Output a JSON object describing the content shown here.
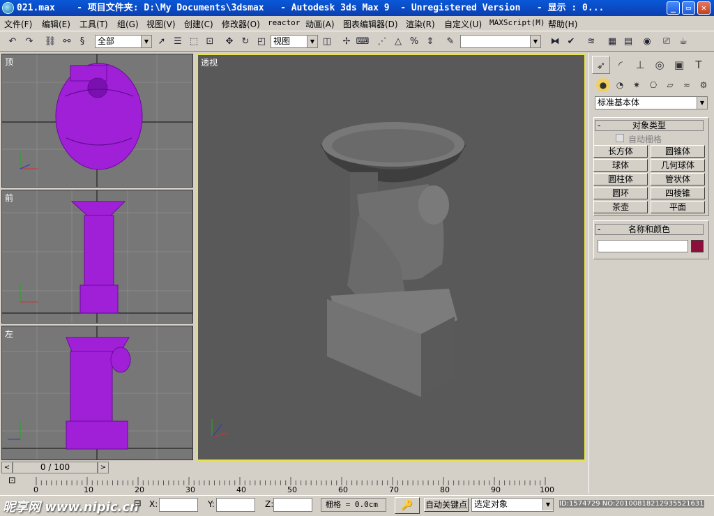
{
  "window": {
    "title": "021.max    - 项目文件夹: D:\\My Documents\\3dsmax   - Autodesk 3ds Max 9  - Unregistered Version   - 显示 : 0...",
    "controls": {
      "minimize": "_",
      "maximize": "▭",
      "close": "✕"
    }
  },
  "menu": [
    "文件(F)",
    "编辑(E)",
    "工具(T)",
    "组(G)",
    "视图(V)",
    "创建(C)",
    "修改器(O)",
    "reactor",
    "动画(A)",
    "图表编辑器(D)",
    "渲染(R)",
    "自定义(U)",
    "MAXScript(M)",
    "帮助(H)"
  ],
  "toolbar": {
    "selection_filter": "全部",
    "ref_coord": "视图",
    "named_selection": ""
  },
  "viewports": {
    "top": "顶",
    "front": "前",
    "left": "左",
    "perspective": "透视"
  },
  "command_panel": {
    "category": "标准基本体",
    "object_type_title": "对象类型",
    "autogrid": "自动栅格",
    "buttons": [
      "长方体",
      "圆锥体",
      "球体",
      "几何球体",
      "圆柱体",
      "管状体",
      "圆环",
      "四棱锥",
      "茶壶",
      "平面"
    ],
    "name_color_title": "名称和颜色",
    "name_value": "",
    "object_color": "#8b0f3a"
  },
  "timeline": {
    "slider": "0 / 100",
    "ticks": [
      "0",
      "10",
      "20",
      "30",
      "40",
      "50",
      "60",
      "70",
      "80",
      "90",
      "100"
    ]
  },
  "status": {
    "x_label": "X:",
    "y_label": "Y:",
    "z_label": "Z:",
    "grid": "栅格 = 0.0cm",
    "auto_key": "自动关键点",
    "set_key_dropdown": "选定对象",
    "watermark": "昵享网 www.nipic.cn",
    "id_text": "ID:1574729 NO:20100818212935521631"
  },
  "colors": {
    "model": "#a020d8",
    "title_bar": "#0b47c4",
    "persp_border": "#e8e34a"
  }
}
